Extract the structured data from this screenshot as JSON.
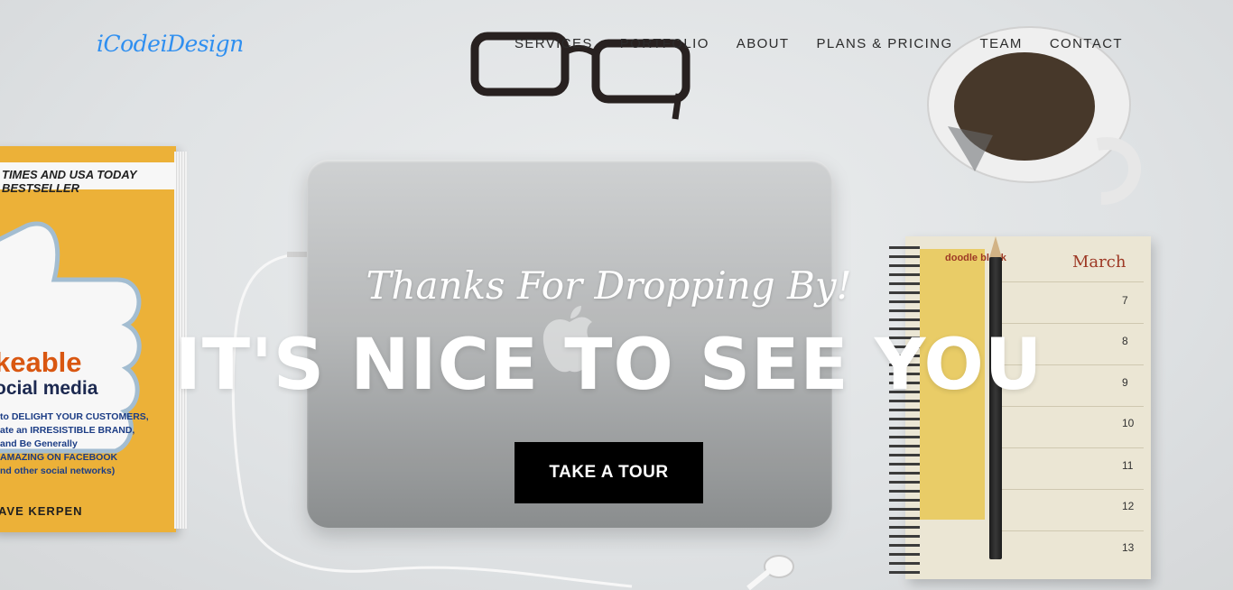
{
  "brand": {
    "logo_text": "iCodeiDesign",
    "logo_color": "#2f8ff0"
  },
  "nav": {
    "items": [
      {
        "label": "SERVICES"
      },
      {
        "label": "PORTFOLIO"
      },
      {
        "label": "ABOUT"
      },
      {
        "label": "PLANS & PRICING"
      },
      {
        "label": "TEAM"
      },
      {
        "label": "CONTACT"
      }
    ]
  },
  "hero": {
    "tagline": "Thanks For Dropping By!",
    "headline": "IT'S NICE TO SEE YOU",
    "cta_label": "TAKE A TOUR",
    "cta_color": "#000000"
  },
  "background_photo": {
    "book": {
      "band": "TIMES AND USA TODAY BESTSELLER",
      "title_1": "keable",
      "title_2": "ocial media",
      "lines": [
        "to DELIGHT YOUR CUSTOMERS,",
        "ate an IRRESISTIBLE BRAND,",
        "and Be Generally",
        "AMAZING ON FACEBOOK",
        "nd other social networks)"
      ],
      "author": "AVE KERPEN"
    },
    "notebook": {
      "month": "March",
      "doodle": "doodle block",
      "days": [
        "7",
        "8",
        "9",
        "10",
        "11",
        "12",
        "13"
      ]
    }
  }
}
